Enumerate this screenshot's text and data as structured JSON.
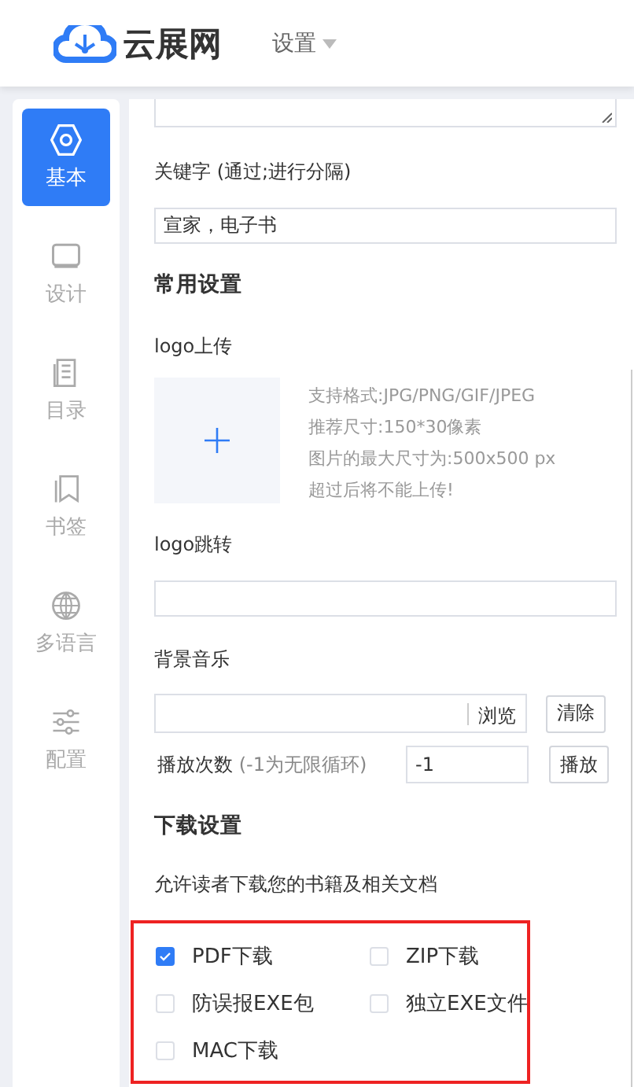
{
  "header": {
    "brand": "云展网",
    "menu": {
      "label": "设置"
    }
  },
  "sidebar": {
    "items": [
      {
        "label": "基本",
        "kind": "hexagon",
        "selected": true
      },
      {
        "label": "设计",
        "kind": "monitor",
        "selected": false
      },
      {
        "label": "目录",
        "kind": "document",
        "selected": false
      },
      {
        "label": "书签",
        "kind": "bookmark",
        "selected": false
      },
      {
        "label": "多语言",
        "kind": "globe",
        "selected": false
      },
      {
        "label": "配置",
        "kind": "sliders",
        "selected": false
      }
    ]
  },
  "form": {
    "keywords": {
      "label": "关键字 (通过;进行分隔)",
      "value": "宣家，电子书"
    },
    "common_heading": "常用设置",
    "logo_upload": {
      "label": "logo上传",
      "hints": [
        "支持格式:JPG/PNG/GIF/JPEG",
        "推荐尺寸:150*30像素",
        "图片的最大尺寸为:500x500 px",
        "超过后将不能上传!"
      ]
    },
    "logo_link": {
      "label": "logo跳转"
    },
    "music": {
      "label": "背景音乐",
      "browse": "浏览",
      "clear": "清除"
    },
    "play_count": {
      "label": "播放次数",
      "hint": "(-1为无限循环)",
      "value": "-1",
      "button": "播放"
    },
    "download_heading": "下载设置",
    "download_desc": "允许读者下载您的书籍及相关文档",
    "downloads": [
      {
        "label": "PDF下载",
        "checked": true
      },
      {
        "label": "ZIP下载",
        "checked": false
      },
      {
        "label": "防误报EXE包",
        "checked": false
      },
      {
        "label": "独立EXE文件",
        "checked": false
      },
      {
        "label": "MAC下载",
        "checked": false
      }
    ]
  }
}
